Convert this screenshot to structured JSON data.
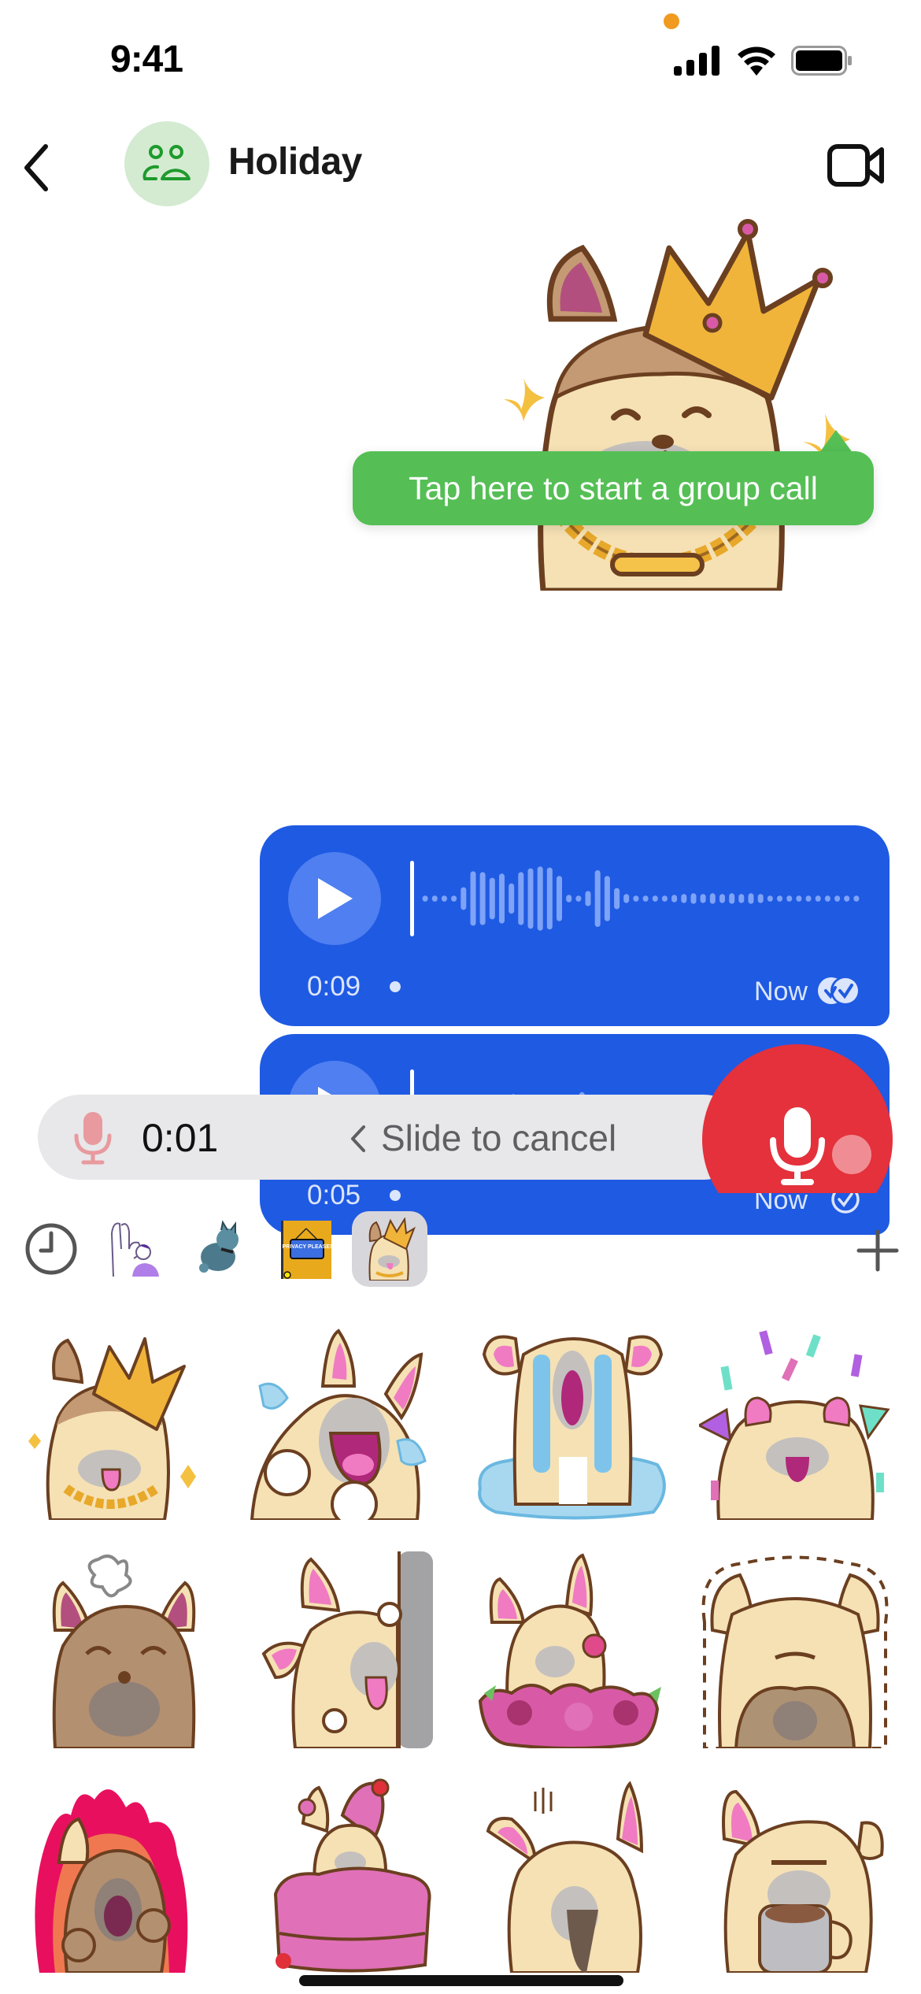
{
  "status_bar": {
    "time": "9:41",
    "icons": [
      "privacy-indicator-dot",
      "signal-icon",
      "wifi-icon",
      "battery-icon"
    ]
  },
  "header": {
    "back_icon": "chevron-left-icon",
    "avatar_icon": "group-icon",
    "title": "Holiday",
    "video_icon": "video-camera-icon"
  },
  "colors": {
    "accent_green": "#55bf55",
    "avatar_bg": "#d4ebd2",
    "avatar_icon": "#1e9a2c",
    "bubble_blue": "#1f5ae3",
    "record_red": "#e4313c",
    "record_bar_bg": "#e8e7ea"
  },
  "tooltip": {
    "text": "Tap here to start a group call"
  },
  "messages": [
    {
      "type": "sticker",
      "description": "French bulldog wearing crown and gold bone chain"
    },
    {
      "type": "voice",
      "duration": "0:09",
      "time": "Now",
      "status": "read",
      "status_icon": "double-check-read-icon",
      "waveform": [
        0.08,
        0.08,
        0.08,
        0.08,
        0.3,
        0.72,
        0.7,
        0.55,
        0.66,
        0.4,
        0.7,
        0.8,
        0.85,
        0.82,
        0.6,
        0.1,
        0.08,
        0.2,
        0.75,
        0.6,
        0.28,
        0.12,
        0.08,
        0.08,
        0.08,
        0.08,
        0.1,
        0.12,
        0.14,
        0.12,
        0.14,
        0.12,
        0.14,
        0.12,
        0.14,
        0.12,
        0.08,
        0.08,
        0.08,
        0.08,
        0.08,
        0.08,
        0.08,
        0.08,
        0.08,
        0.08
      ]
    },
    {
      "type": "voice",
      "duration": "0:05",
      "time": "Now",
      "status": "delivered",
      "status_icon": "check-circle-icon",
      "waveform": [
        0.1,
        0.12,
        0.12,
        0.12,
        0.12,
        0.14,
        0.14,
        0.18,
        0.3,
        0.35,
        0.2,
        0.14,
        0.08,
        0.08,
        0.08,
        0.14,
        0.4,
        0.2,
        0.16,
        0.16,
        0.14,
        0.14,
        0.12,
        0.16,
        0.16,
        0.14,
        0.14,
        0.18,
        0.16,
        0.14,
        0.12,
        0.14,
        0.14,
        0.12,
        0.14,
        0.12,
        0.2,
        0.35,
        0.48,
        0.42,
        0.28,
        0.24,
        0.2,
        0.08,
        0.08
      ]
    }
  ],
  "recording": {
    "mic_icon": "microphone-icon",
    "elapsed": "0:01",
    "slide_hint": "Slide to cancel",
    "chevron_icon": "chevron-left-icon",
    "record_button_icon": "microphone-icon"
  },
  "sticker_packs": {
    "tabs": [
      {
        "name": "recents",
        "icon": "clock-icon",
        "active": false
      },
      {
        "name": "hand-gesture-pack",
        "icon": "hand-sticker-thumb",
        "active": false
      },
      {
        "name": "cat-pack",
        "icon": "cat-sticker-thumb",
        "active": false
      },
      {
        "name": "privacy-pack",
        "icon": "privacy-sign-thumb",
        "label": "PRIVACY PLEASE!",
        "active": false
      },
      {
        "name": "bulldog-pack",
        "icon": "bulldog-crown-thumb",
        "active": true
      }
    ],
    "add_icon": "plus-icon"
  },
  "stickers": [
    {
      "id": "crown-king",
      "desc": "Bulldog with crown and chain"
    },
    {
      "id": "laugh-cry",
      "desc": "Bulldog laughing with tears"
    },
    {
      "id": "crying-puddle",
      "desc": "Bulldog crying in puddle"
    },
    {
      "id": "celebrate",
      "desc": "Bulldog celebrating with confetti"
    },
    {
      "id": "angry",
      "desc": "Grumpy bulldog with scribble cloud"
    },
    {
      "id": "peek",
      "desc": "Bulldog peeking from behind wall"
    },
    {
      "id": "flowers",
      "desc": "Bulldog with rose among flowers"
    },
    {
      "id": "hide-face",
      "desc": "Bulldog covering face"
    },
    {
      "id": "fire-rage",
      "desc": "Bulldog yelling with flames"
    },
    {
      "id": "cake",
      "desc": "Bulldog popping out of cake"
    },
    {
      "id": "shocked",
      "desc": "Bulldog biting paw nervously"
    },
    {
      "id": "coffee",
      "desc": "Tired bulldog holding coffee mug"
    }
  ]
}
